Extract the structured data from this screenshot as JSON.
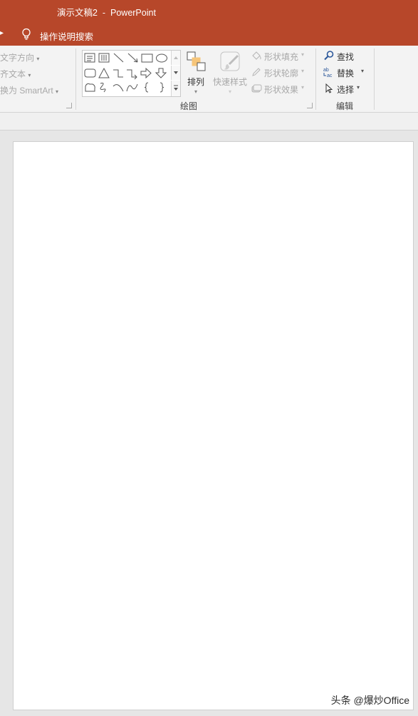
{
  "window": {
    "title": "演示文稿2  -  PowerPoint",
    "tell_me_placeholder": "操作说明搜索",
    "title_bar_color": "#b7472a"
  },
  "ribbon": {
    "paragraph_group": {
      "text_direction": "文字方向",
      "align_text": "对齐文本",
      "convert_smartart": "转换为 SmartArt",
      "visible_fragments": [
        "文字方向",
        "齐文本",
        "换为 SmartArt"
      ]
    },
    "drawing_group": {
      "label": "绘图",
      "arrange_label": "排列",
      "quick_styles_label": "快速样式",
      "shape_fill": "形状填充",
      "shape_outline": "形状轮廓",
      "shape_effects": "形状效果",
      "shapes": [
        "text-box",
        "vertical-text-box",
        "line",
        "arrow-line",
        "rectangle",
        "oval",
        "rounded-rectangle",
        "triangle",
        "elbow-connector",
        "elbow-arrow-connector",
        "right-arrow",
        "down-arrow",
        "freeform",
        "scribble",
        "arc",
        "curve",
        "left-brace",
        "right-brace"
      ]
    },
    "editing_group": {
      "label": "编辑",
      "find": "查找",
      "replace": "替换",
      "select": "选择"
    }
  },
  "watermark": "头条 @爆炒Office"
}
